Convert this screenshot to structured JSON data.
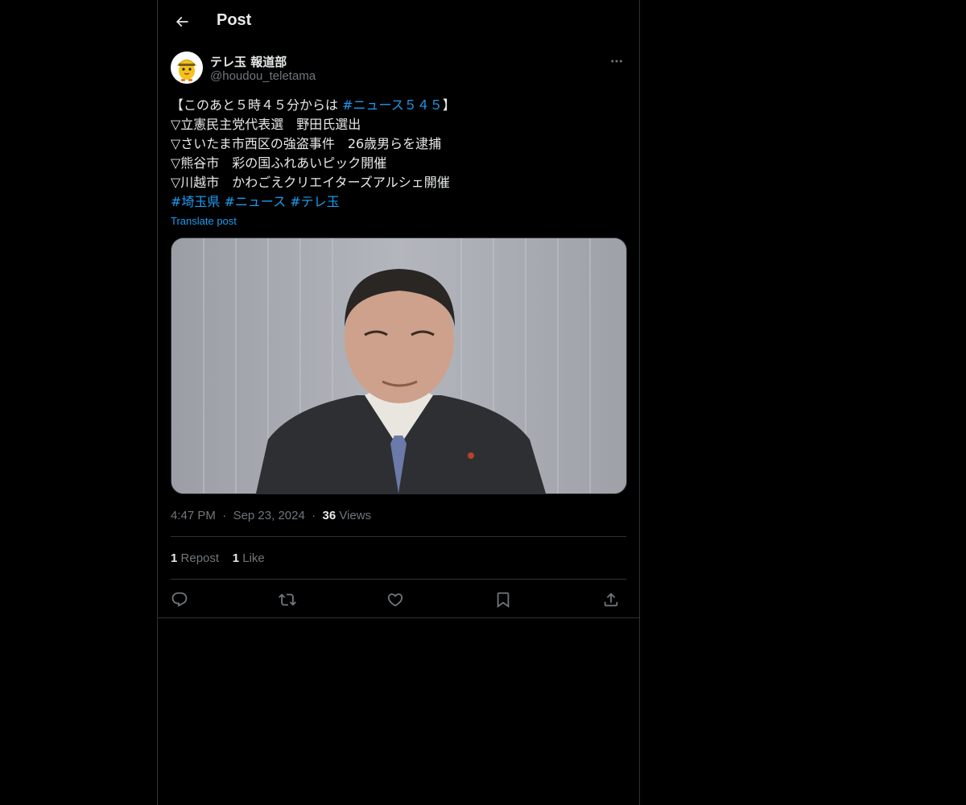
{
  "header": {
    "title": "Post"
  },
  "author": {
    "display_name": "テレ玉 報道部",
    "handle": "@houdou_teletama"
  },
  "post": {
    "lines": [
      [
        {
          "t": "【このあと５時４５分からは ",
          "tag": false
        },
        {
          "t": "#ニュース５４５",
          "tag": true
        },
        {
          "t": "】",
          "tag": false
        }
      ],
      [
        {
          "t": "▽立憲民主党代表選　野田氏選出",
          "tag": false
        }
      ],
      [
        {
          "t": "▽さいたま市西区の強盗事件　26歳男らを逮捕",
          "tag": false
        }
      ],
      [
        {
          "t": "▽熊谷市　彩の国ふれあいピック開催",
          "tag": false
        }
      ],
      [
        {
          "t": "▽川越市　かわごえクリエイターズアルシェ開催",
          "tag": false
        }
      ],
      [
        {
          "t": "#埼玉県",
          "tag": true
        },
        {
          "t": " ",
          "tag": false
        },
        {
          "t": "#ニュース",
          "tag": true
        },
        {
          "t": " ",
          "tag": false
        },
        {
          "t": "#テレ玉",
          "tag": true
        }
      ]
    ],
    "translate_label": "Translate post",
    "time": "4:47 PM",
    "date": "Sep 23, 2024",
    "views_count": "36",
    "views_label": "Views",
    "separator": "·"
  },
  "stats": {
    "repost_count": "1",
    "repost_label": "Repost",
    "like_count": "1",
    "like_label": "Like"
  },
  "icons": {
    "back": "arrow-left-icon",
    "more": "more-horizontal-icon",
    "reply": "reply-icon",
    "retweet": "repost-icon",
    "like": "heart-icon",
    "bookmark": "bookmark-icon",
    "share": "share-icon"
  },
  "colors": {
    "background": "#000000",
    "text": "#e7e9ea",
    "muted": "#71767b",
    "link": "#1d9bf0",
    "border": "#2f3336"
  }
}
